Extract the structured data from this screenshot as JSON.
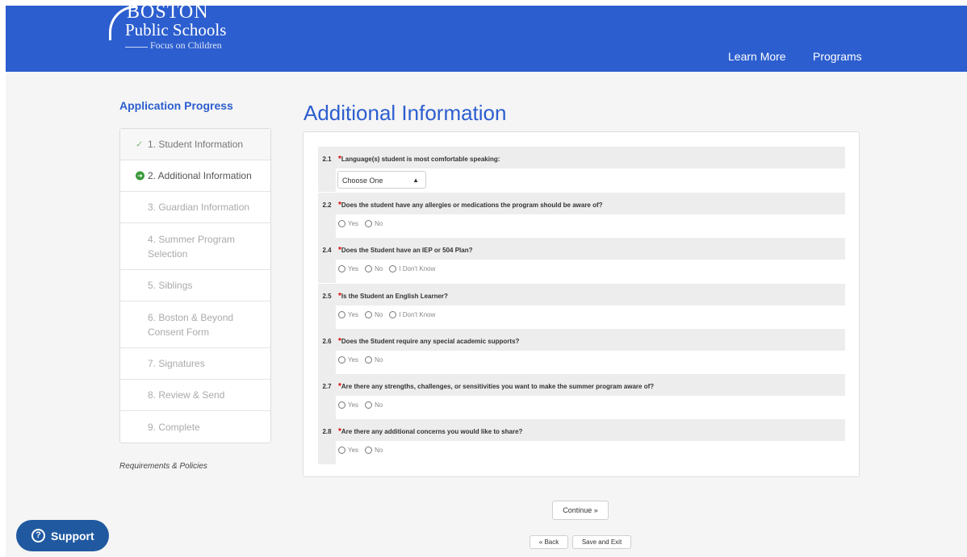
{
  "header": {
    "logo": {
      "line1": "BOSTON",
      "line2": "Public Schools",
      "line3": "Focus on Children"
    },
    "nav": [
      {
        "label": "Learn More"
      },
      {
        "label": "Programs"
      }
    ]
  },
  "sidebar": {
    "title": "Application Progress",
    "steps": [
      {
        "label": "1. Student Information",
        "state": "done"
      },
      {
        "label": "2. Additional Information",
        "state": "current"
      },
      {
        "label": "3. Guardian Information",
        "state": "pending"
      },
      {
        "label": "4. Summer Program Selection",
        "state": "pending"
      },
      {
        "label": "5. Siblings",
        "state": "pending"
      },
      {
        "label": "6. Boston & Beyond Consent Form",
        "state": "pending"
      },
      {
        "label": "7. Signatures",
        "state": "pending"
      },
      {
        "label": "8. Review & Send",
        "state": "pending"
      },
      {
        "label": "9. Complete",
        "state": "pending"
      }
    ],
    "requirements_link": "Requirements & Policies"
  },
  "main": {
    "title": "Additional Information",
    "questions": [
      {
        "num": "2.1",
        "label": "Language(s) student is most comfortable speaking:",
        "select_value": "Choose One"
      },
      {
        "num": "2.2",
        "label": "Does the student have any allergies or medications the program should be aware of?",
        "options": [
          "Yes",
          "No"
        ]
      },
      {
        "num": "2.4",
        "label": "Does the Student have an IEP or 504 Plan?",
        "options": [
          "Yes",
          "No",
          "I Don't Know"
        ]
      },
      {
        "num": "2.5",
        "label": "Is the Student an English Learner?",
        "options": [
          "Yes",
          "No",
          "I Don't Know"
        ]
      },
      {
        "num": "2.6",
        "label": "Does the Student require any special academic supports?",
        "options": [
          "Yes",
          "No"
        ]
      },
      {
        "num": "2.7",
        "label": "Are there any strengths, challenges, or sensitivities you want to make the summer program aware of?",
        "options": [
          "Yes",
          "No"
        ]
      },
      {
        "num": "2.8",
        "label": "Are there any additional concerns you would like to share?",
        "options": [
          "Yes",
          "No"
        ]
      }
    ],
    "required_mark": "*"
  },
  "buttons": {
    "continue": "Continue »",
    "back": "« Back",
    "save_exit": "Save and Exit"
  },
  "support": {
    "label": "Support",
    "icon_glyph": "?"
  },
  "colors": {
    "brand_blue": "#2c5ecf",
    "required_red": "#dd0000",
    "support_blue": "#2059a0"
  },
  "icons": {
    "done": "check-icon",
    "current": "arrow-circle-icon",
    "caret": "select-caret-icon"
  }
}
